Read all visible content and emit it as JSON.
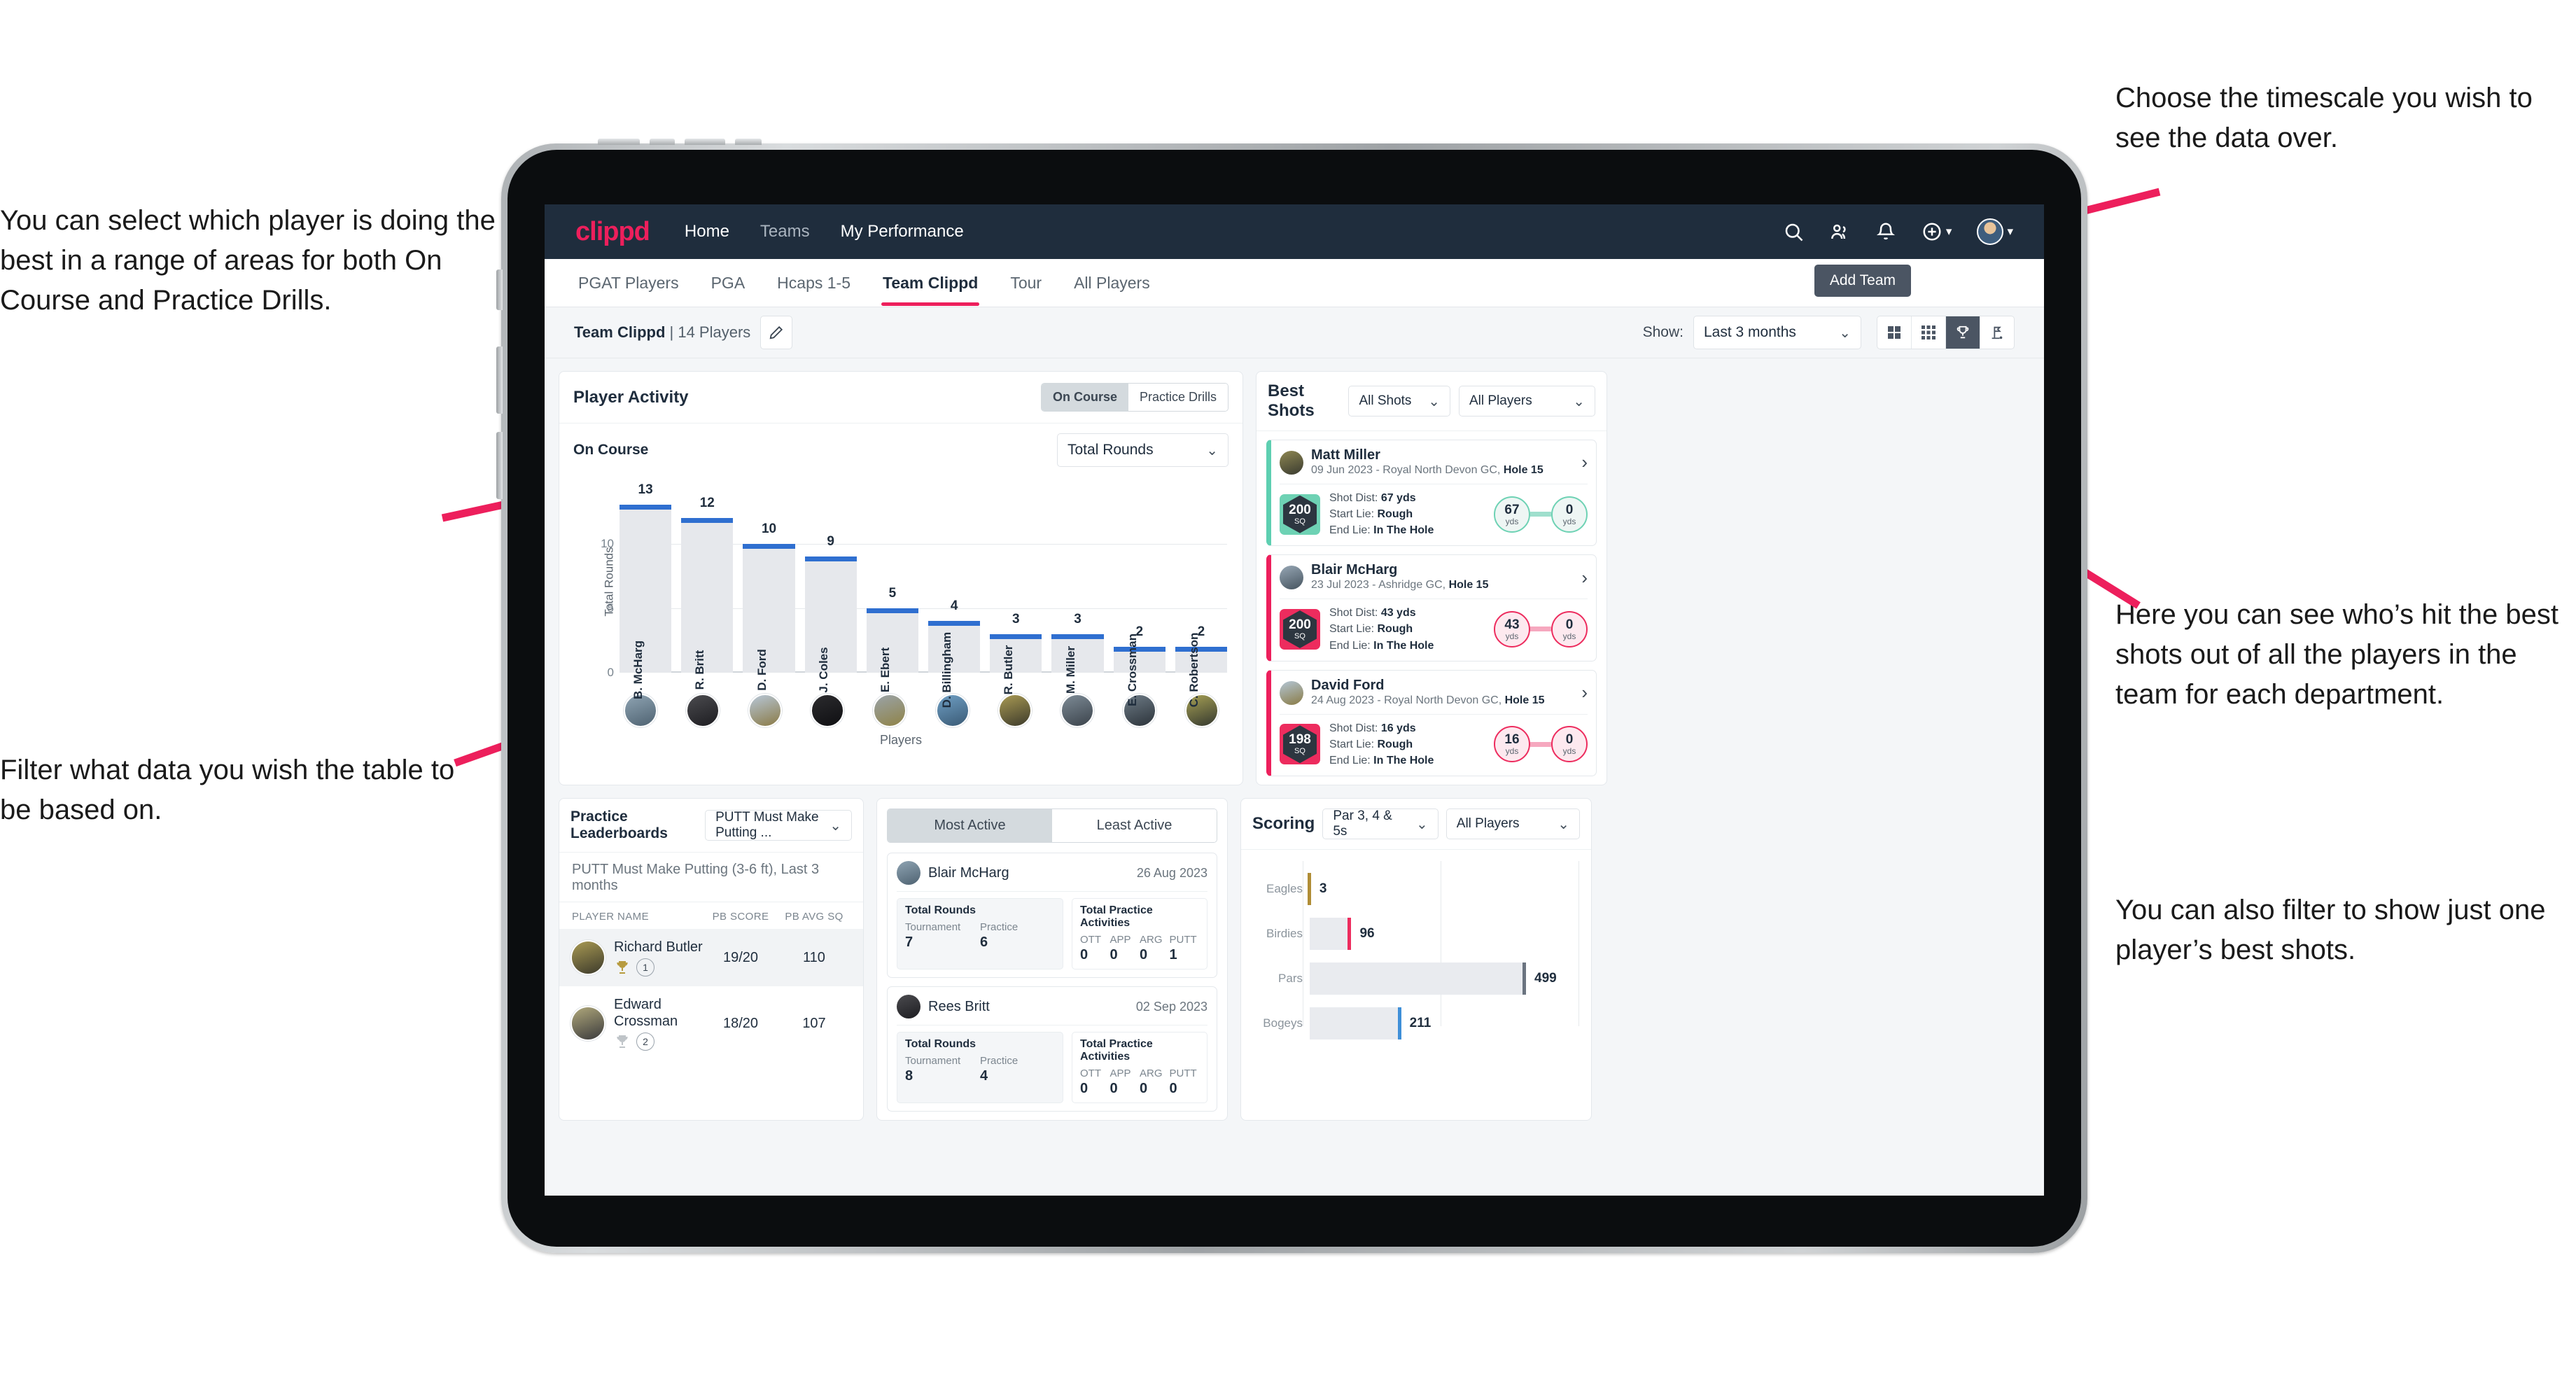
{
  "annotations": {
    "left_top": "You can select which player is doing the best in a range of areas for both On Course and Practice Drills.",
    "left_bottom": "Filter what data you wish the table to be based on.",
    "right_top": "Choose the timescale you wish to see the data over.",
    "right_mid": "Here you can see who’s hit the best shots out of all the players in the team for each department.",
    "right_bottom": "You can also filter to show just one player’s best shots."
  },
  "topnav": {
    "logo": "clippd",
    "links": [
      {
        "label": "Home",
        "active": true
      },
      {
        "label": "Teams",
        "active": false
      },
      {
        "label": "My Performance",
        "active": true
      }
    ],
    "icons": [
      "search-icon",
      "people-icon",
      "bell-icon",
      "plus-circle-icon",
      "avatar-icon"
    ]
  },
  "tabs": [
    {
      "label": "PGAT Players",
      "active": false
    },
    {
      "label": "PGA",
      "active": false
    },
    {
      "label": "Hcaps 1-5",
      "active": false
    },
    {
      "label": "Team Clippd",
      "active": true
    },
    {
      "label": "Tour",
      "active": false
    },
    {
      "label": "All Players",
      "active": false
    }
  ],
  "add_team_button": "Add Team",
  "subbar": {
    "team_name": "Team Clippd",
    "team_count": " | 14 Players",
    "edit_icon": "pencil-icon",
    "show_label": "Show:",
    "period_value": "Last 3 months",
    "view_icons": [
      "grid-4-icon",
      "grid-9-icon",
      "trophy-icon",
      "golf-flag-icon"
    ],
    "view_active_index": 2
  },
  "player_activity": {
    "title": "Player Activity",
    "segments": [
      {
        "label": "On Course",
        "active": true
      },
      {
        "label": "Practice Drills",
        "active": false
      }
    ],
    "sub_label": "On Course",
    "metric_value": "Total Rounds"
  },
  "chart_data": [
    {
      "type": "bar",
      "title": "Player Activity",
      "xlabel": "Players",
      "ylabel": "Total Rounds",
      "ylim": [
        0,
        14
      ],
      "yticks": [
        0,
        5,
        10
      ],
      "grid": true,
      "categories": [
        "B. McHarg",
        "R. Britt",
        "D. Ford",
        "J. Coles",
        "E. Ebert",
        "D. Billingham",
        "R. Butler",
        "M. Miller",
        "E. Crossman",
        "C. Robertson"
      ],
      "values": [
        13,
        12,
        10,
        9,
        5,
        4,
        3,
        3,
        2,
        2
      ]
    },
    {
      "type": "bar",
      "orientation": "horizontal",
      "title": "Scoring",
      "categories": [
        "Eagles",
        "Birdies",
        "Pars",
        "Bogeys"
      ],
      "values": [
        3,
        96,
        499,
        211
      ],
      "colors": [
        "#b08d36",
        "#ed2c5e",
        "#6b7480",
        "#3f8fd8"
      ],
      "xlim": [
        0,
        620
      ],
      "grid": true
    }
  ],
  "best_shots": {
    "title": "Best Shots",
    "filter_shots": "All Shots",
    "filter_players": "All Players",
    "cards": [
      {
        "player": "Matt Miller",
        "meta_date": "09 Jun 2023 - Royal North Devon GC, ",
        "meta_hole": "Hole 15",
        "sq": "200",
        "sq_unit": "SQ",
        "accent": "teal",
        "shot_dist_label": "Shot Dist: ",
        "shot_dist": "67 yds",
        "start_lie_label": "Start Lie: ",
        "start_lie": "Rough",
        "end_lie_label": "End Lie: ",
        "end_lie": "In The Hole",
        "from_val": "67",
        "from_unit": "yds",
        "to_val": "0",
        "to_unit": "yds"
      },
      {
        "player": "Blair McHarg",
        "meta_date": "23 Jul 2023 - Ashridge GC, ",
        "meta_hole": "Hole 15",
        "sq": "200",
        "sq_unit": "SQ",
        "accent": "pink",
        "shot_dist_label": "Shot Dist: ",
        "shot_dist": "43 yds",
        "start_lie_label": "Start Lie: ",
        "start_lie": "Rough",
        "end_lie_label": "End Lie: ",
        "end_lie": "In The Hole",
        "from_val": "43",
        "from_unit": "yds",
        "to_val": "0",
        "to_unit": "yds"
      },
      {
        "player": "David Ford",
        "meta_date": "24 Aug 2023 - Royal North Devon GC, ",
        "meta_hole": "Hole 15",
        "sq": "198",
        "sq_unit": "SQ",
        "accent": "pink",
        "shot_dist_label": "Shot Dist: ",
        "shot_dist": "16 yds",
        "start_lie_label": "Start Lie: ",
        "start_lie": "Rough",
        "end_lie_label": "End Lie: ",
        "end_lie": "In The Hole",
        "from_val": "16",
        "from_unit": "yds",
        "to_val": "0",
        "to_unit": "yds"
      }
    ]
  },
  "practice_leaderboards": {
    "title": "Practice Leaderboards",
    "drill_select": "PUTT Must Make Putting ...",
    "sub_title": "PUTT Must Make Putting (3-6 ft),",
    "sub_period": " Last 3 months",
    "columns": [
      "PLAYER NAME",
      "PB SCORE",
      "PB AVG SQ"
    ],
    "rows": [
      {
        "name": "Richard Butler",
        "rank": "1",
        "trophy": "gold",
        "pb_score": "19/20",
        "pb_avg_sq": "110",
        "highlight": true
      },
      {
        "name": "Edward Crossman",
        "rank": "2",
        "trophy": "silver",
        "pb_score": "18/20",
        "pb_avg_sq": "107",
        "highlight": false
      }
    ]
  },
  "activity_panel": {
    "tabs": [
      {
        "label": "Most Active",
        "active": true
      },
      {
        "label": "Least Active",
        "active": false
      }
    ],
    "cards": [
      {
        "player": "Blair McHarg",
        "date": "26 Aug 2023",
        "rounds_title": "Total Rounds",
        "rounds": [
          {
            "k": "Tournament",
            "v": "7"
          },
          {
            "k": "Practice",
            "v": "6"
          }
        ],
        "practice_title": "Total Practice Activities",
        "practice": [
          {
            "k": "OTT",
            "v": "0"
          },
          {
            "k": "APP",
            "v": "0"
          },
          {
            "k": "ARG",
            "v": "0"
          },
          {
            "k": "PUTT",
            "v": "1"
          }
        ]
      },
      {
        "player": "Rees Britt",
        "date": "02 Sep 2023",
        "rounds_title": "Total Rounds",
        "rounds": [
          {
            "k": "Tournament",
            "v": "8"
          },
          {
            "k": "Practice",
            "v": "4"
          }
        ],
        "practice_title": "Total Practice Activities",
        "practice": [
          {
            "k": "OTT",
            "v": "0"
          },
          {
            "k": "APP",
            "v": "0"
          },
          {
            "k": "ARG",
            "v": "0"
          },
          {
            "k": "PUTT",
            "v": "0"
          }
        ]
      }
    ]
  },
  "scoring": {
    "title": "Scoring",
    "filter_par": "Par 3, 4 & 5s",
    "filter_players": "All Players"
  },
  "colors": {
    "brand_pink": "#ed1f5c",
    "nav_dark": "#1f2d3d",
    "bar_blue": "#2f6fd0",
    "teal": "#6ed2b4",
    "gold": "#b08d36"
  }
}
